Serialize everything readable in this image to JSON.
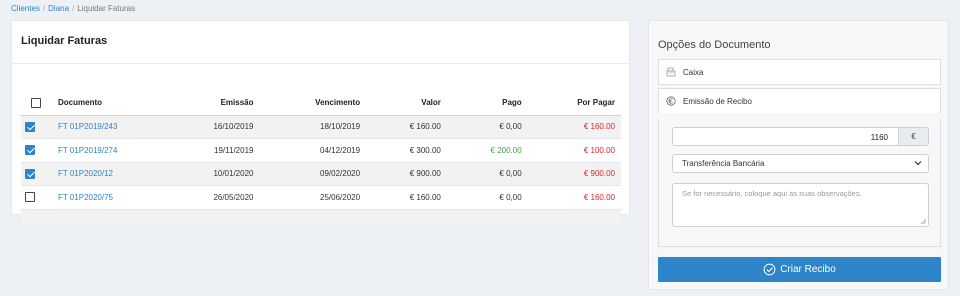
{
  "breadcrumb": [
    "Clientes",
    "Diana",
    "Liquidar Faturas"
  ],
  "invoices": {
    "title": "Liquidar Faturas",
    "columns": [
      "Documento",
      "Emissão",
      "Vencimento",
      "Valor",
      "Pago",
      "Por Pagar"
    ],
    "rows": [
      {
        "checked": true,
        "documento": "FT 01P2019/243",
        "emissao": "16/10/2019",
        "vencimento": "18/10/2019",
        "valor": "€ 160.00",
        "pago": "€ 0,00",
        "por_pagar": "€ 160.00"
      },
      {
        "checked": true,
        "documento": "FT 01P2019/274",
        "emissao": "19/11/2019",
        "vencimento": "04/12/2019",
        "valor": "€ 300.00",
        "pago": "€ 200.00",
        "por_pagar": "€ 100.00"
      },
      {
        "checked": true,
        "documento": "FT 01P2020/12",
        "emissao": "10/01/2020",
        "vencimento": "09/02/2020",
        "valor": "€ 900.00",
        "pago": "€ 0,00",
        "por_pagar": "€ 900.00"
      },
      {
        "checked": false,
        "documento": "FT 01P2020/75",
        "emissao": "26/05/2020",
        "vencimento": "25/06/2020",
        "valor": "€ 160.00",
        "pago": "€ 0,00",
        "por_pagar": "€ 160.00"
      }
    ]
  },
  "options": {
    "title": "Opções do Documento",
    "caixa_label": "Caixa",
    "recibo_label": "Emissão de Recibo",
    "amount_value": "1160",
    "currency": "€",
    "payment_method": "Transferência Bancária",
    "notes_placeholder": "Se for necessário, coloque aqui as suas observações.",
    "submit_label": "Criar Recibo"
  },
  "colors": {
    "accent": "#2e84c9",
    "paid": "#3fa540",
    "due": "#d9282e"
  }
}
